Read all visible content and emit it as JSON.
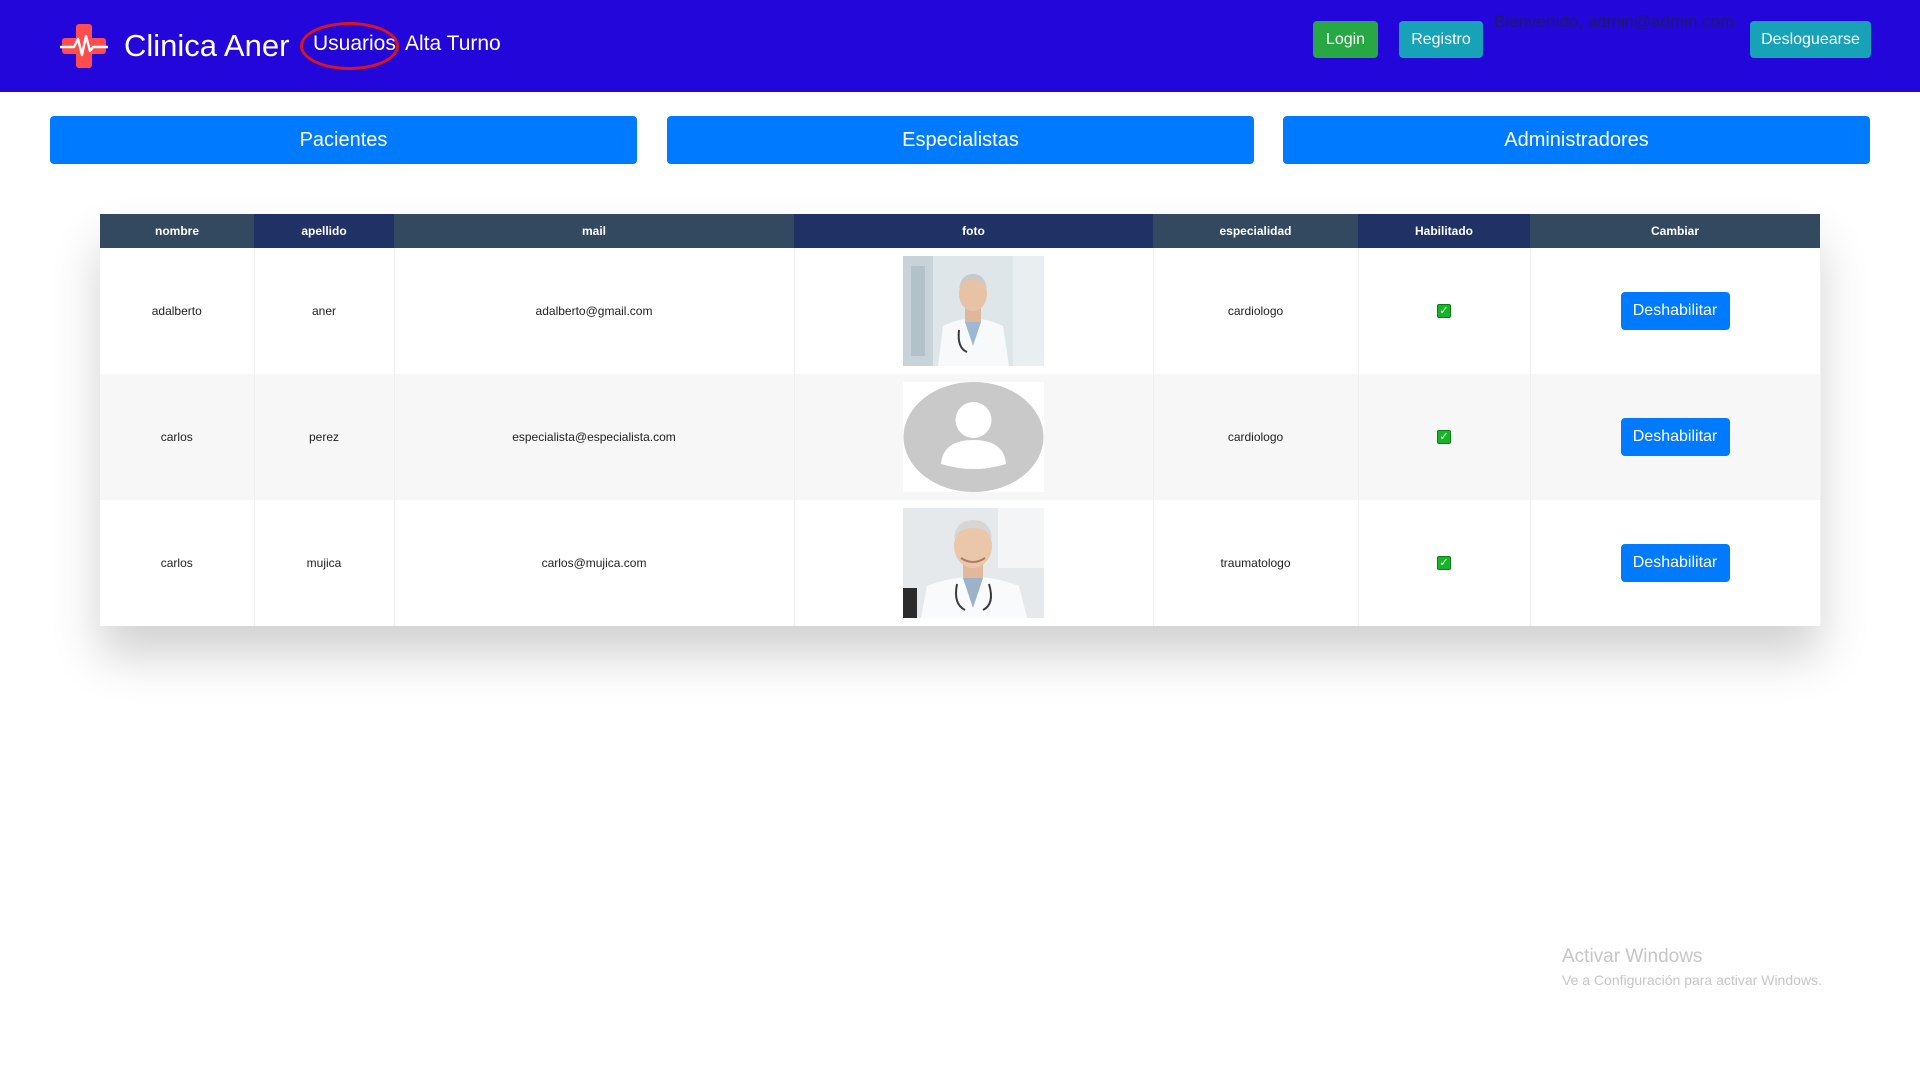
{
  "brand": {
    "name": "Clinica Aner"
  },
  "nav": {
    "links": [
      {
        "label": "Usuarios",
        "highlighted": true
      },
      {
        "label": "Alta Turno"
      }
    ],
    "login_label": "Login",
    "registro_label": "Registro",
    "welcome_text": "Bienvenido, admin@admin.com",
    "logout_label": "Desloguearse"
  },
  "categories": {
    "pacientes": "Pacientes",
    "especialistas": "Especialistas",
    "administradores": "Administradores"
  },
  "table": {
    "headers": {
      "nombre": "nombre",
      "apellido": "apellido",
      "mail": "mail",
      "foto": "foto",
      "especialidad": "especialidad",
      "habilitado": "Habilitado",
      "cambiar": "Cambiar"
    },
    "rows": [
      {
        "nombre": "adalberto",
        "apellido": "aner",
        "mail": "adalberto@gmail.com",
        "foto": "doctor-photo",
        "especialidad": "cardiologo",
        "habilitado": true,
        "action_label": "Deshabilitar"
      },
      {
        "nombre": "carlos",
        "apellido": "perez",
        "mail": "especialista@especialista.com",
        "foto": "default-avatar",
        "especialidad": "cardiologo",
        "habilitado": true,
        "action_label": "Deshabilitar"
      },
      {
        "nombre": "carlos",
        "apellido": "mujica",
        "mail": "carlos@mujica.com",
        "foto": "doctor-photo",
        "especialidad": "traumatologo",
        "habilitado": true,
        "action_label": "Deshabilitar"
      }
    ]
  },
  "watermark": {
    "title": "Activar Windows",
    "subtitle": "Ve a Configuración para activar Windows."
  },
  "colors": {
    "navbar": "#2306d9",
    "primary": "#007bff",
    "success": "#28a745",
    "info": "#17a2b8",
    "header_dark": "#324960",
    "header_navy": "#1f3165",
    "highlight": "#d9161f"
  }
}
